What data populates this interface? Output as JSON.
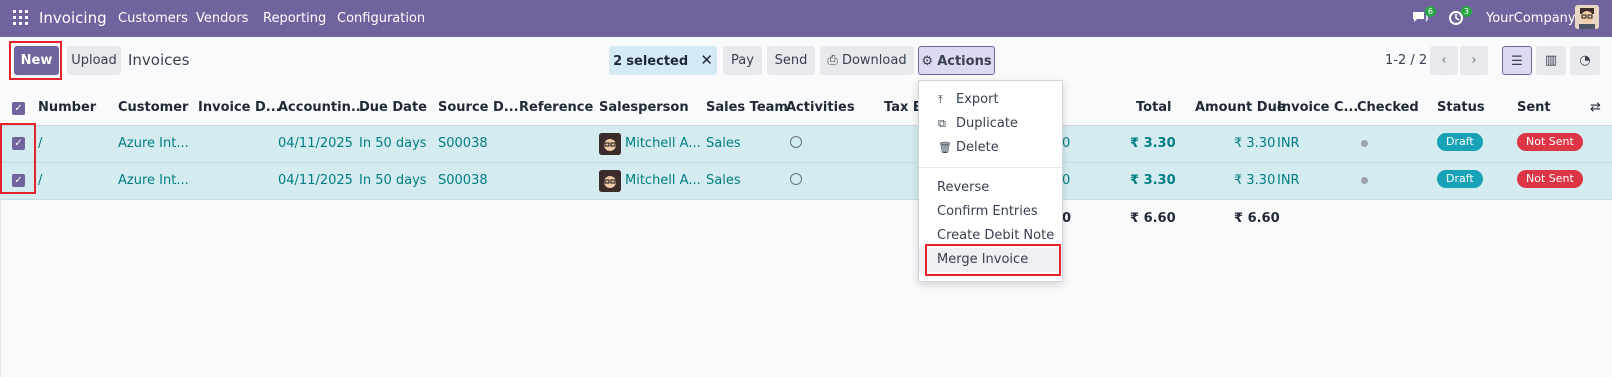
{
  "navbar": {
    "brand": "Invoicing",
    "menus": [
      "Customers",
      "Vendors",
      "Reporting",
      "Configuration"
    ],
    "messages_badge": "6",
    "activities_badge": "3",
    "company": "YourCompany"
  },
  "control": {
    "new_label": "New",
    "upload_label": "Upload",
    "title": "Invoices",
    "selected_count": "2",
    "selected_text": "selected",
    "pay_label": "Pay",
    "send_label": "Send",
    "download_label": "Download",
    "actions_label": "Actions",
    "pager": "1-2 / 2"
  },
  "table": {
    "headers": [
      "Number",
      "Customer",
      "Invoice D...",
      "Accountin...",
      "Due Date",
      "Source D...",
      "Reference",
      "Salesperson",
      "Sales Team",
      "Activities",
      "Tax Ex",
      "Total",
      "Amount Due",
      "Invoice C...",
      "Checked",
      "Status",
      "Sent"
    ],
    "rows": [
      {
        "number": "/",
        "customer": "Azure Int...",
        "accounting_date": "04/11/2025",
        "due_date": "In 50 days",
        "source": "S00038",
        "salesperson": "Mitchell A...",
        "sales_team": "Sales",
        "tax_tail": "0",
        "total": "₹ 3.30",
        "amount_due": "₹ 3.30",
        "currency": "INR",
        "status": "Draft",
        "sent": "Not Sent"
      },
      {
        "number": "/",
        "customer": "Azure Int...",
        "accounting_date": "04/11/2025",
        "due_date": "In 50 days",
        "source": "S00038",
        "salesperson": "Mitchell A...",
        "sales_team": "Sales",
        "tax_tail": "0",
        "total": "₹ 3.30",
        "amount_due": "₹ 3.30",
        "currency": "INR",
        "status": "Draft",
        "sent": "Not Sent"
      }
    ],
    "totals": {
      "tax_tail": "0",
      "total": "₹ 6.60",
      "amount_due": "₹ 6.60"
    }
  },
  "actions_menu": {
    "export": "Export",
    "duplicate": "Duplicate",
    "delete": "Delete",
    "reverse": "Reverse",
    "confirm_entries": "Confirm Entries",
    "create_debit_note": "Create Debit Note",
    "merge_invoice": "Merge Invoice"
  },
  "colors": {
    "brand": "#71639e",
    "draft": "#17a2b8",
    "not_sent": "#dc3545",
    "link": "#017e84"
  }
}
